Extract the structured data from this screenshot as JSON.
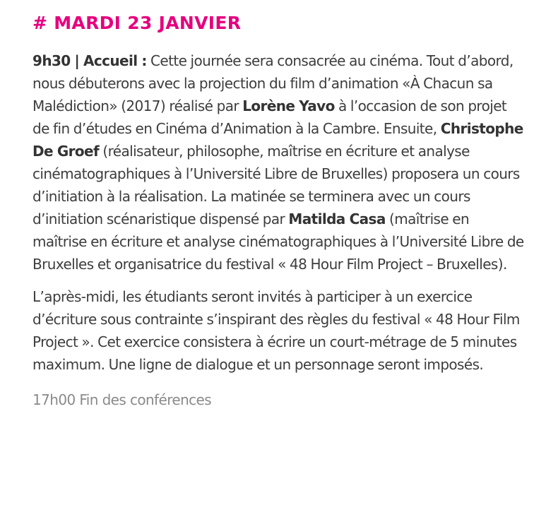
{
  "heading": "# MARDI 23 JANVIER",
  "p1": {
    "s0": "9h30 | Accueil :",
    "s1": " Cette journée sera consacrée au cinéma. Tout d’abord, nous débuterons avec la projection du film d’animation «À Chacun sa Malédiction» (2017) réalisé par ",
    "s2": "Lorène Yavo",
    "s3": " à l’occasion de son projet de fin d’études en Cinéma d’Animation à la Cambre. Ensuite, ",
    "s4": "Christophe De Groef",
    "s5": " (réalisateur, philosophe, maîtrise en écriture et analyse cinématographiques à l’Université Libre de Bruxelles) proposera un cours d’initiation à la réalisation. La matinée se terminera avec un cours d’initiation scénaristique dispensé par ",
    "s6": "Matilda Casa",
    "s7": " (maîtrise en maîtrise en écriture et analyse cinématographiques à l’Université Libre de Bruxelles et organisatrice du festival « 48 Hour Film Project – Bruxelles)."
  },
  "p2": "L’après-midi, les étudiants seront invités à participer à un exercice d’écriture sous contrainte s’inspirant des règles du festival « 48 Hour Film Project ». Cet exercice consistera à écrire un court-métrage de 5 minutes maximum. Une ligne de dialogue et un personnage seront imposés.",
  "footer": "17h00 Fin des conférences",
  "colors": {
    "heading": "#e6007e",
    "body_text": "#3d3d3d",
    "footer_text": "#8a8a8a"
  }
}
